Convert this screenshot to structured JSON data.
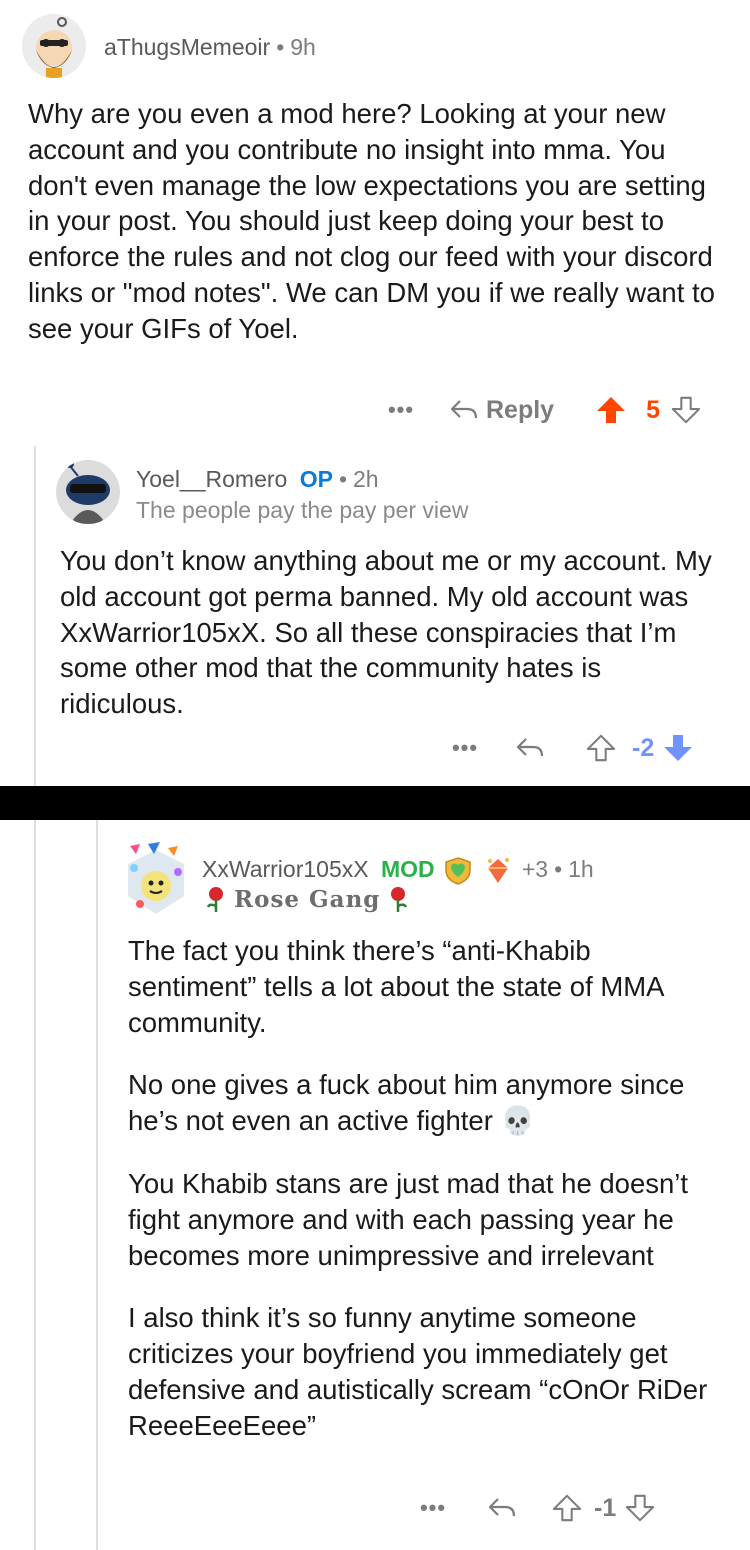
{
  "comments": [
    {
      "author": "aThugsMemeoir",
      "time": "9h",
      "body": "Why are you even a mod here? Looking at your new account and you contribute no insight into mma. You don't even manage the low expectations you are setting in your post. You should just keep doing your best to enforce the rules and not clog our feed with your discord links or \"mod notes\". We can DM you if we really want to see your GIFs of Yoel.",
      "reply_label": "Reply",
      "score": "5",
      "vote_state": "upvoted"
    },
    {
      "author": "Yoel__Romero",
      "op_badge": "OP",
      "time": "2h",
      "flair": "The people pay the pay per view",
      "body": "You don’t know anything about me or my account. My old account got perma banned. My old account was XxWarrior105xX. So all these conspiracies that I’m some other mod that the community hates is ridiculous.",
      "score": "-2",
      "vote_state": "downvoted"
    },
    {
      "author": "XxWarrior105xX",
      "mod_badge": "MOD",
      "award_count": "+3",
      "time": "1h",
      "flair": "Rose Gang",
      "paragraphs": [
        "The fact you think there’s “anti-Khabib sentiment” tells a lot about the state of MMA community.",
        "No one gives a fuck about him anymore since he’s not even an active fighter 💀",
        "You Khabib stans are just mad that he doesn’t fight anymore and with each passing year he becomes more unimpressive and irrelevant",
        "I also think it’s so funny anytime someone criticizes your boyfriend you immediately get defensive and autistically scream “cOnOr RiDer ReeeEeeEeee”"
      ],
      "score": "-1",
      "vote_state": "none"
    }
  ],
  "colors": {
    "upvote": "#ff4500",
    "downvote": "#7193ff",
    "op": "#0a7bdb",
    "mod": "#2ab24a",
    "meta": "#7c7c7c"
  },
  "icons": [
    "more-icon",
    "reply-icon",
    "upvote-icon",
    "downvote-icon",
    "skull-emoji",
    "rose-icon",
    "shield-award-icon",
    "crystal-award-icon"
  ]
}
